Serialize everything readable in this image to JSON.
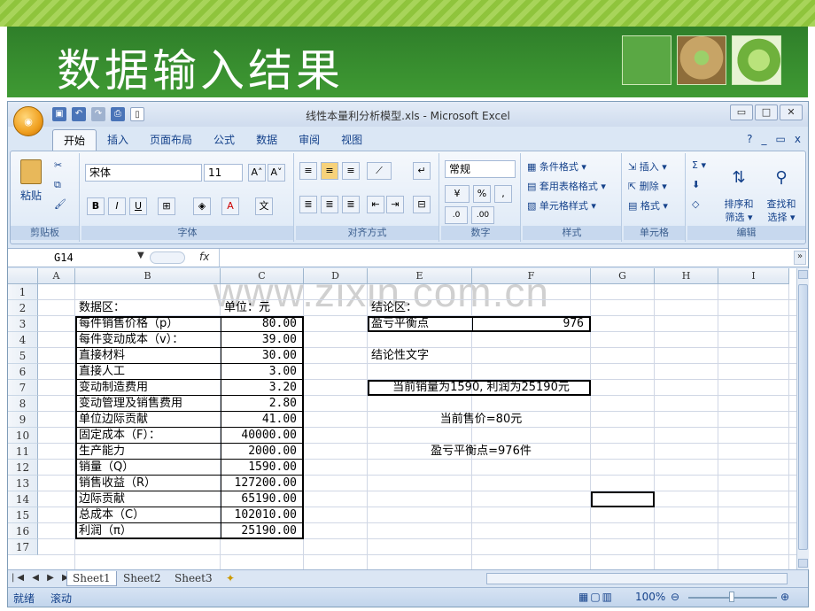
{
  "slide": {
    "title": "数据输入结果"
  },
  "window": {
    "title": "线性本量利分析模型.xls - Microsoft Excel",
    "controls": [
      "▭",
      "□",
      "✕"
    ]
  },
  "ribbon": {
    "tabs": [
      "开始",
      "插入",
      "页面布局",
      "公式",
      "数据",
      "审阅",
      "视图"
    ],
    "active_tab": "开始",
    "help_controls": [
      "?",
      "_",
      "▭",
      "x"
    ],
    "groups": {
      "clipboard": {
        "label": "剪贴板",
        "paste": "粘贴"
      },
      "font": {
        "label": "字体",
        "font_name": "宋体",
        "font_size": "11",
        "bold": "B",
        "italic": "I",
        "underline": "U"
      },
      "alignment": {
        "label": "对齐方式"
      },
      "number": {
        "label": "数字",
        "format": "常规",
        "percent": "%",
        "comma": ","
      },
      "styles": {
        "label": "样式",
        "items": [
          "条件格式 ▾",
          "套用表格格式 ▾",
          "单元格样式 ▾"
        ]
      },
      "cells": {
        "label": "单元格",
        "items": [
          "插入 ▾",
          "删除 ▾",
          "格式 ▾"
        ]
      },
      "editing": {
        "label": "编辑",
        "sort": "排序和\n筛选 ▾",
        "find": "查找和\n选择 ▾",
        "sigma": "Σ ▾"
      }
    }
  },
  "formula_bar": {
    "name_box": "G14",
    "fx": "fx",
    "value": ""
  },
  "columns": [
    "A",
    "B",
    "C",
    "D",
    "E",
    "F",
    "G",
    "H",
    "I"
  ],
  "rows": [
    "1",
    "2",
    "3",
    "4",
    "5",
    "6",
    "7",
    "8",
    "9",
    "10",
    "11",
    "12",
    "13",
    "14",
    "15",
    "16",
    "17"
  ],
  "cells": {
    "B2": "数据区：",
    "C2": "单位：元",
    "B3": "每件销售价格（p）",
    "C3": "80.00",
    "B4": "每件变动成本（v）：",
    "C4": "39.00",
    "B5": " 直接材料",
    "C5": "30.00",
    "B6": " 直接人工",
    "C6": "3.00",
    "B7": " 变动制造费用",
    "C7": "3.20",
    "B8": " 变动管理及销售费用",
    "C8": "2.80",
    "B9": "单位边际贡献",
    "C9": "41.00",
    "B10": "固定成本（F）：",
    "C10": "40000.00",
    "B11": "生产能力",
    "C11": "2000.00",
    "B12": "销量（Q）",
    "C12": "1590.00",
    "B13": "销售收益（R）",
    "C13": "127200.00",
    "B14": "边际贡献",
    "C14": "65190.00",
    "B15": "总成本（C）",
    "C15": "102010.00",
    "B16": "利润（π）",
    "C16": "25190.00",
    "E2": "结论区：",
    "E3": "盈亏平衡点",
    "F3": "976",
    "E5": "结论性文字",
    "E7": "当前销量为1590, 利润为25190元",
    "E9": "当前售价=80元",
    "E11": "盈亏平衡点=976件"
  },
  "watermark": "www.zixin.com.cn",
  "sheets": [
    "Sheet1",
    "Sheet2",
    "Sheet3"
  ],
  "active_sheet": "Sheet1",
  "status": {
    "ready": "就绪",
    "scroll": "滚动",
    "zoom": "100%"
  }
}
